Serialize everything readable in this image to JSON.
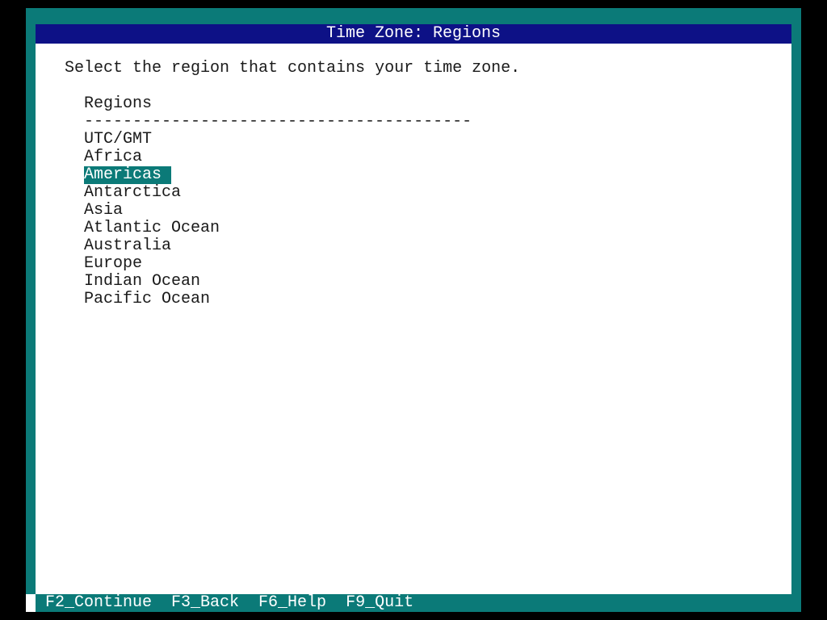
{
  "window": {
    "title": "Time Zone: Regions"
  },
  "main": {
    "instruction": "Select the region that contains your time zone.",
    "list_header": "Regions",
    "list_divider": "----------------------------------------",
    "items": [
      {
        "label": "UTC/GMT",
        "selected": false
      },
      {
        "label": "Africa",
        "selected": false
      },
      {
        "label": "Americas",
        "selected": true
      },
      {
        "label": "Antarctica",
        "selected": false
      },
      {
        "label": "Asia",
        "selected": false
      },
      {
        "label": "Atlantic Ocean",
        "selected": false
      },
      {
        "label": "Australia",
        "selected": false
      },
      {
        "label": "Europe",
        "selected": false
      },
      {
        "label": "Indian Ocean",
        "selected": false
      },
      {
        "label": "Pacific Ocean",
        "selected": false
      }
    ]
  },
  "footer": {
    "continue_label": "F2_Continue",
    "back_label": "F3_Back",
    "help_label": "F6_Help",
    "quit_label": "F9_Quit"
  },
  "colors": {
    "frame": "#0b7a78",
    "title_bar": "#0d1186",
    "panel": "#ffffff",
    "selection": "#0b7a78"
  }
}
